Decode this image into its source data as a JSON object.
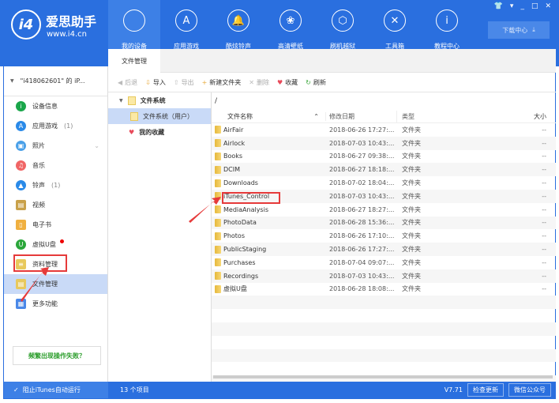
{
  "app": {
    "logo_name": "爱思助手",
    "logo_url": "www.i4.cn",
    "logo_mark": "i4"
  },
  "nav": [
    {
      "label": "我的设备",
      "icon": "apple-icon",
      "glyph": ""
    },
    {
      "label": "应用游戏",
      "icon": "appstore-icon",
      "glyph": "A"
    },
    {
      "label": "酷炫铃声",
      "icon": "bell-icon",
      "glyph": "🔔"
    },
    {
      "label": "高清壁纸",
      "icon": "flower-icon",
      "glyph": "❀"
    },
    {
      "label": "刷机越狱",
      "icon": "dropbox-icon",
      "glyph": "⬡"
    },
    {
      "label": "工具箱",
      "icon": "tools-icon",
      "glyph": "✕"
    },
    {
      "label": "教程中心",
      "icon": "info-icon",
      "glyph": "i"
    }
  ],
  "window_controls": [
    "👕",
    "▾",
    "_",
    "□",
    "✕"
  ],
  "download_center": "下载中心",
  "device_name": "\"i418062601\" 的 iP...",
  "sidebar": [
    {
      "label": "设备信息",
      "count": "",
      "color": "#1aa64a",
      "glyph": "i"
    },
    {
      "label": "应用游戏",
      "count": "(1)",
      "color": "#2a8ae8",
      "glyph": "A"
    },
    {
      "label": "照片",
      "count": "",
      "color": "#4aa0e8",
      "glyph": "▣"
    },
    {
      "label": "音乐",
      "count": "",
      "color": "#f06565",
      "glyph": "♫"
    },
    {
      "label": "铃声",
      "count": "(1)",
      "color": "#2a8ae8",
      "glyph": "▲"
    },
    {
      "label": "视频",
      "count": "",
      "color": "#c9a14a",
      "glyph": "▤"
    },
    {
      "label": "电子书",
      "count": "",
      "color": "#f0b040",
      "glyph": "▯"
    },
    {
      "label": "虚拟U盘",
      "count": "",
      "color": "#2aa63a",
      "glyph": "U"
    },
    {
      "label": "资料管理",
      "count": "",
      "color": "#e8c95c",
      "glyph": "≡"
    },
    {
      "label": "文件管理",
      "count": "",
      "color": "#e8c95c",
      "glyph": "▤"
    },
    {
      "label": "更多功能",
      "count": "",
      "color": "#4a88e8",
      "glyph": "▦"
    }
  ],
  "help_button": "频繁出现操作失败？",
  "tab": "文件管理",
  "toolbar": [
    {
      "label": "后退",
      "disabled": true,
      "glyph": "◀",
      "color": "#bbb"
    },
    {
      "label": "导入",
      "disabled": false,
      "glyph": "⇩",
      "color": "#e8a93a"
    },
    {
      "label": "导出",
      "disabled": true,
      "glyph": "⇧",
      "color": "#bbb"
    },
    {
      "label": "新建文件夹",
      "disabled": false,
      "glyph": "+",
      "color": "#e8a93a"
    },
    {
      "label": "删除",
      "disabled": true,
      "glyph": "✕",
      "color": "#bbb"
    },
    {
      "label": "收藏",
      "disabled": false,
      "glyph": "♥",
      "color": "#e84a5a"
    },
    {
      "label": "刷新",
      "disabled": false,
      "glyph": "↻",
      "color": "#3aa63a"
    }
  ],
  "tree": {
    "root": "文件系统",
    "child": "文件系统（用户）",
    "favorites": "我的收藏"
  },
  "path": "/",
  "columns": [
    "文件名称",
    "修改日期",
    "类型",
    "大小"
  ],
  "files": [
    {
      "name": "AirFair",
      "date": "2018-06-26 17:27:...",
      "type": "文件夹",
      "size": "--"
    },
    {
      "name": "Airlock",
      "date": "2018-07-03 10:43:...",
      "type": "文件夹",
      "size": "--"
    },
    {
      "name": "Books",
      "date": "2018-06-27 09:38:...",
      "type": "文件夹",
      "size": "--"
    },
    {
      "name": "DCIM",
      "date": "2018-06-27 18:18:...",
      "type": "文件夹",
      "size": "--"
    },
    {
      "name": "Downloads",
      "date": "2018-07-02 18:04:...",
      "type": "文件夹",
      "size": "--"
    },
    {
      "name": "iTunes_Control",
      "date": "2018-07-03 10:43:...",
      "type": "文件夹",
      "size": "--"
    },
    {
      "name": "MediaAnalysis",
      "date": "2018-06-27 18:27:...",
      "type": "文件夹",
      "size": "--"
    },
    {
      "name": "PhotoData",
      "date": "2018-06-28 15:36:...",
      "type": "文件夹",
      "size": "--"
    },
    {
      "name": "Photos",
      "date": "2018-06-26 17:10:...",
      "type": "文件夹",
      "size": "--"
    },
    {
      "name": "PublicStaging",
      "date": "2018-06-26 17:27:...",
      "type": "文件夹",
      "size": "--"
    },
    {
      "name": "Purchases",
      "date": "2018-07-04 09:07:...",
      "type": "文件夹",
      "size": "--"
    },
    {
      "name": "Recordings",
      "date": "2018-07-03 10:43:...",
      "type": "文件夹",
      "size": "--"
    },
    {
      "name": "虚拟U盘",
      "date": "2018-06-28 18:08:...",
      "type": "文件夹",
      "size": "--"
    }
  ],
  "status": {
    "itunes_block": "阻止iTunes自动运行",
    "item_count": "13 个项目",
    "version": "V7.71",
    "check_update": "检查更新",
    "wechat": "微信公众号"
  }
}
